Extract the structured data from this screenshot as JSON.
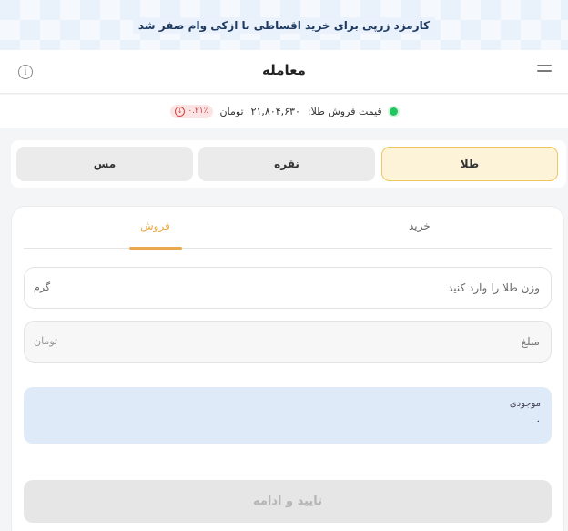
{
  "banner": {
    "text": "کارمزد زرپی برای خرید اقساطی با ازکی وام صفر شد"
  },
  "header": {
    "title": "معامله",
    "menu_icon": "hamburger-menu-icon",
    "info_icon": "info-icon",
    "info_glyph": "i"
  },
  "price": {
    "label": "قیمت فروش طلا:",
    "value": "۲۱,۸۰۴,۶۳۰",
    "unit": "تومان",
    "change": "۰.۲۱٪",
    "change_icon": "down-arrow-circle-icon",
    "change_glyph": "↓",
    "status_color": "#22c55e",
    "change_color": "#d14343"
  },
  "metals": {
    "items": [
      {
        "label": "طلا",
        "active": true
      },
      {
        "label": "نقره",
        "active": false
      },
      {
        "label": "مس",
        "active": false
      }
    ]
  },
  "trade": {
    "tabs": [
      {
        "label": "خرید",
        "active": false
      },
      {
        "label": "فروش",
        "active": true
      }
    ],
    "accent_color": "#e9a94a",
    "weight": {
      "placeholder": "وزن طلا را وارد کنید",
      "value": "",
      "unit": "گرم"
    },
    "amount": {
      "placeholder": "مبلغ",
      "value": "",
      "unit": "تومان"
    },
    "balance": {
      "label": "موجودی",
      "value": "۰"
    },
    "confirm_label": "تایید و ادامه"
  }
}
